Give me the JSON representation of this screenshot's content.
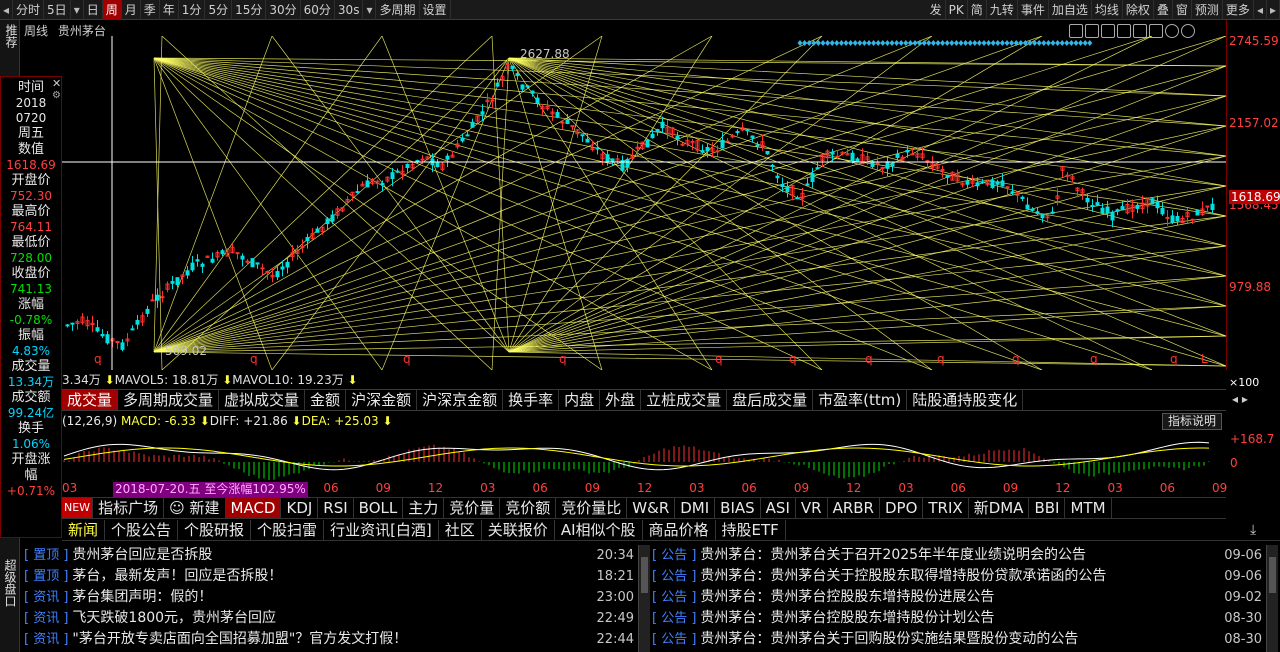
{
  "toolbar": {
    "items": [
      "分时",
      "5日",
      "日",
      "周",
      "月",
      "季",
      "年",
      "1分",
      "5分",
      "15分",
      "30分",
      "60分",
      "30s",
      "多周期",
      "设置"
    ],
    "active": "周",
    "right_items": [
      "发",
      "PK",
      "简",
      "九转",
      "事件",
      "加自选",
      "均线",
      "除权",
      "叠",
      "窗",
      "预测",
      "更多"
    ]
  },
  "side_tabs": {
    "top": "推荐",
    "bottom": "超级盘口"
  },
  "chart": {
    "period_label": "周线",
    "stock_name": "贵州茅台",
    "y_ticks": [
      "2745.59",
      "2157.02",
      "1568.45",
      "979.88"
    ],
    "current_price": "1618.69",
    "high_label": "2627.88",
    "low_label": "509.02",
    "axis_scale": "×100"
  },
  "info_panel": {
    "time_label": "时间",
    "year": "2018",
    "date": "0720",
    "weekday": "周五",
    "value_label": "数值",
    "value": "1618.69",
    "open_label": "开盘价",
    "open": "752.30",
    "high_label": "最高价",
    "high": "764.11",
    "low_label": "最低价",
    "low": "728.00",
    "close_label": "收盘价",
    "close": "741.13",
    "change_label": "涨幅",
    "change": "-0.78%",
    "amplitude_label": "振幅",
    "amplitude": "4.83%",
    "volume_label": "成交量",
    "volume": "13.34万",
    "amount_label": "成交额",
    "amount": "99.24亿",
    "turnover_label": "换手",
    "turnover": "1.06%",
    "open_change_label": "开盘涨幅",
    "open_change": "+0.71%"
  },
  "volume_line": {
    "vol": "3.34万",
    "mavol5": "MAVOL5: 18.81万",
    "mavol10": "MAVOL10: 19.23万"
  },
  "indicator_tabs": [
    "成交量",
    "多周期成交量",
    "虚拟成交量",
    "金额",
    "沪深金额",
    "沪深京金额",
    "换手率",
    "内盘",
    "外盘",
    "立桩成交量",
    "盘后成交量",
    "市盈率(ttm)",
    "陆股通持股变化"
  ],
  "macd_line": {
    "params": "(12,26,9)",
    "macd": "MACD: -6.33",
    "diff": "DIFF: +21.86",
    "dea": "DEA: +25.03"
  },
  "macd_help": "指标说明",
  "macd_axis": [
    "+168.7",
    "0"
  ],
  "x_labels": [
    "03",
    "06",
    "09",
    "12",
    "03",
    "06",
    "09",
    "12",
    "03",
    "06",
    "09",
    "12",
    "03",
    "06",
    "09",
    "12",
    "03",
    "06",
    "09",
    "12",
    "03",
    "06",
    "09"
  ],
  "range_label": "2018-07-20.五 至今涨幅102.95%",
  "indicator_bar": {
    "new_badge": "NEW",
    "items": [
      "指标广场",
      "新建",
      "MACD",
      "KDJ",
      "RSI",
      "BOLL",
      "主力",
      "竞价量",
      "竞价额",
      "竞价量比",
      "W&R",
      "DMI",
      "BIAS",
      "ASI",
      "VR",
      "ARBR",
      "DPO",
      "TRIX",
      "新DMA",
      "BBI",
      "MTM"
    ],
    "active": "MACD"
  },
  "news_tabs": [
    "新闻",
    "个股公告",
    "个股研报",
    "个股扫雷",
    "行业资讯[白酒]",
    "社区",
    "关联报价",
    "AI相似个股",
    "商品价格",
    "持股ETF"
  ],
  "news_left": [
    {
      "type": "置顶",
      "title": "贵州茅台回应是否拆股",
      "time": "20:34"
    },
    {
      "type": "置顶",
      "title": "茅台，最新发声！回应是否拆股！",
      "time": "18:21"
    },
    {
      "type": "资讯",
      "title": "茅台集团声明：假的！",
      "time": "23:00"
    },
    {
      "type": "资讯",
      "title": "飞天跌破1800元，贵州茅台回应",
      "time": "22:49"
    },
    {
      "type": "资讯",
      "title": "\"茅台开放专卖店面向全国招募加盟\"？官方发文打假！",
      "time": "22:44"
    }
  ],
  "news_right": [
    {
      "type": "公告",
      "title": "贵州茅台：贵州茅台关于召开2025年半年度业绩说明会的公告",
      "time": "09-06"
    },
    {
      "type": "公告",
      "title": "贵州茅台：贵州茅台关于控股股东取得增持股份贷款承诺函的公告",
      "time": "09-06"
    },
    {
      "type": "公告",
      "title": "贵州茅台：贵州茅台控股股东增持股份进展公告",
      "time": "09-02"
    },
    {
      "type": "公告",
      "title": "贵州茅台：贵州茅台控股股东增持股份计划公告",
      "time": "08-30"
    },
    {
      "type": "公告",
      "title": "贵州茅台：贵州茅台关于回购股份实施结果暨股份变动的公告",
      "time": "08-30"
    }
  ]
}
